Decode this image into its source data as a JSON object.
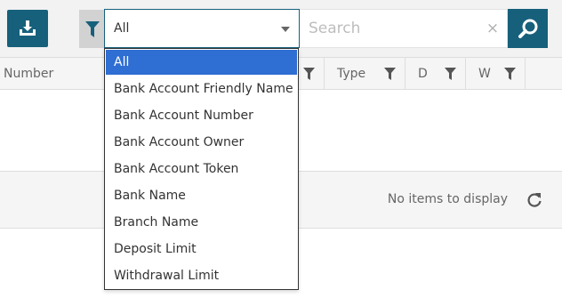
{
  "toolbar": {
    "filter_select": {
      "value": "All"
    },
    "search": {
      "placeholder": "Search",
      "value": "",
      "clear_glyph": "×"
    }
  },
  "grid": {
    "columns": [
      {
        "label": "Number"
      },
      {
        "label": ""
      },
      {
        "label": "Type"
      },
      {
        "label": "D"
      },
      {
        "label": "W"
      }
    ],
    "pager": {
      "info": "No items to display"
    }
  },
  "dropdown": {
    "options": [
      "All",
      "Bank Account Friendly Name",
      "Bank Account Number",
      "Bank Account Owner",
      "Bank Account Token",
      "Bank Name",
      "Branch Name",
      "Deposit Limit",
      "Withdrawal Limit"
    ],
    "selected_index": 0
  },
  "colors": {
    "primary": "#16607c",
    "selected_option": "#2f6ed2",
    "toolbar_bg": "#f2f2f2"
  },
  "icons": {
    "download": "download-icon",
    "filter": "filter-icon",
    "search": "search-icon",
    "refresh": "refresh-icon"
  }
}
